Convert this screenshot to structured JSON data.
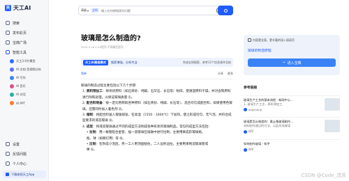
{
  "sidebar": {
    "logo": "天工AI",
    "items": [
      {
        "label": "搜索"
      },
      {
        "label": "发布彩页"
      },
      {
        "label": "宝典广场"
      },
      {
        "label": "智能工具"
      }
    ],
    "tools": [
      {
        "label": "天工3.0大模型",
        "color": "#2f6bff"
      },
      {
        "label": "AI 文档·音视频分析",
        "color": "#5b6cff"
      },
      {
        "label": "AI 写作",
        "color": "#3b82f6"
      },
      {
        "label": "AI 音乐",
        "color": "#e04d8a"
      },
      {
        "label": "AI 对话",
        "color": "#24b2a6"
      },
      {
        "label": "AI PPT",
        "color": "#ff7a2e"
      }
    ],
    "bottom": [
      {
        "label": "设置"
      },
      {
        "label": "反馈问题"
      },
      {
        "label": "个人中心"
      }
    ],
    "download": "下载体验天工App"
  },
  "search": {
    "mode": "高级",
    "all": "全网",
    "placeholder": "输入任何想搜索的问题"
  },
  "article": {
    "title": "玻璃是怎么制造的?",
    "meta": "2024.3.18  1.45提问  不再确定提问",
    "banner_badge": "天工AI高级模式",
    "banner_text": "搜索增强，分析专业",
    "banner_right": "完成全网搜索，参考12个信息源并总结",
    "source_label": "简单",
    "share": "分享",
    "more": "更多",
    "intro": "玻璃的制造过程主要包括以下几个步骤:",
    "steps": [
      {
        "b": "原料预加工",
        "t": "：将块状原料（如石英砂、纯碱、石灰石、长石等）粉碎，使潮湿原料干燥，并对含铁原料进行除铁处理，以保证玻璃质量 ➀。"
      },
      {
        "b": "配合料制备",
        "t": "：按一定比例称取各种原料（如石英砂、纯碱、长石等），混合均匀成配合料。如果使用色玻璃，还需同时加入着色剂 ➁。"
      },
      {
        "b": "熔制",
        "t": "：将配合料送入玻璃熔窑，在高温（1550 - 1600℃）下加热，使之形成均匀、无气泡、并符合成型要求的液态玻璃 ➂。"
      },
      {
        "b": "成型",
        "t": "：将液态玻璃通过不同的成型方法制成各种形状的玻璃制品。常见的成型方法包括:"
      }
    ],
    "forming": [
      {
        "b": "拉制",
        "t": "：用一根锥铂合金管，插一道玻璃在熔融中进行拉制，主要用来成形玻璃瓶、"
      },
      {
        "b": "",
        "t": "瓶、球（如聊灯用）等 ➃。"
      },
      {
        "b": "压制",
        "t": "：在吹成小泡后，另一工人用顶盘粘住，二人边吹边拉，主要用来制造玻璃管或"
      },
      {
        "b": "",
        "t": "棒 ➄。"
      }
    ]
  },
  "panel": {
    "hint": "内容更全面、更丰富的深入阅读页",
    "link": "玻璃的制造原理",
    "button": "进入宝典",
    "ref_title": "参考链接",
    "refs": [
      {
        "title": "玻璃生产工艺的基本流程 - 新闻中心...",
        "desc": "1. 玻璃生产工艺...原料预加工",
        "source": "aoguhong"
      },
      {
        "title": "玻璃是怎么制造的：素土像玻璃制作...",
        "desc": "材料制作通过的方法，以此形成玻璃",
        "source": "知乎"
      },
      {
        "title": "如何制作玻璃 - 知乎",
        "desc": "",
        "source": "知乎"
      }
    ]
  },
  "watermark": "CSDN @Code_流苏"
}
